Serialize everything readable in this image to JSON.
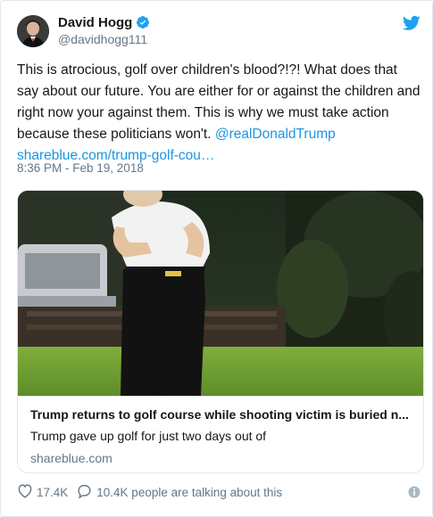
{
  "author": {
    "name": "David Hogg",
    "handle": "@davidhogg111"
  },
  "tweet": {
    "text": "This is atrocious, golf over children's blood?!?! What does that say about our future. You are either for or against the children and right now your against them.  This is why we must take action because these politicians won't. ",
    "mention": "@realDonaldTrump",
    "link": "shareblue.com/trump-golf-cou…",
    "timestamp": "8:36 PM - Feb 19, 2018"
  },
  "card": {
    "title": "Trump returns to golf course while shooting victim is buried n...",
    "description": "Trump gave up golf for just two days out of",
    "domain": "shareblue.com"
  },
  "footer": {
    "likes": "17.4K",
    "talking": "10.4K people are talking about this"
  },
  "colors": {
    "link": "#1b95e0",
    "secondary_text": "#657786",
    "border": "#e1e8ed",
    "verified": "#1da1f2"
  }
}
